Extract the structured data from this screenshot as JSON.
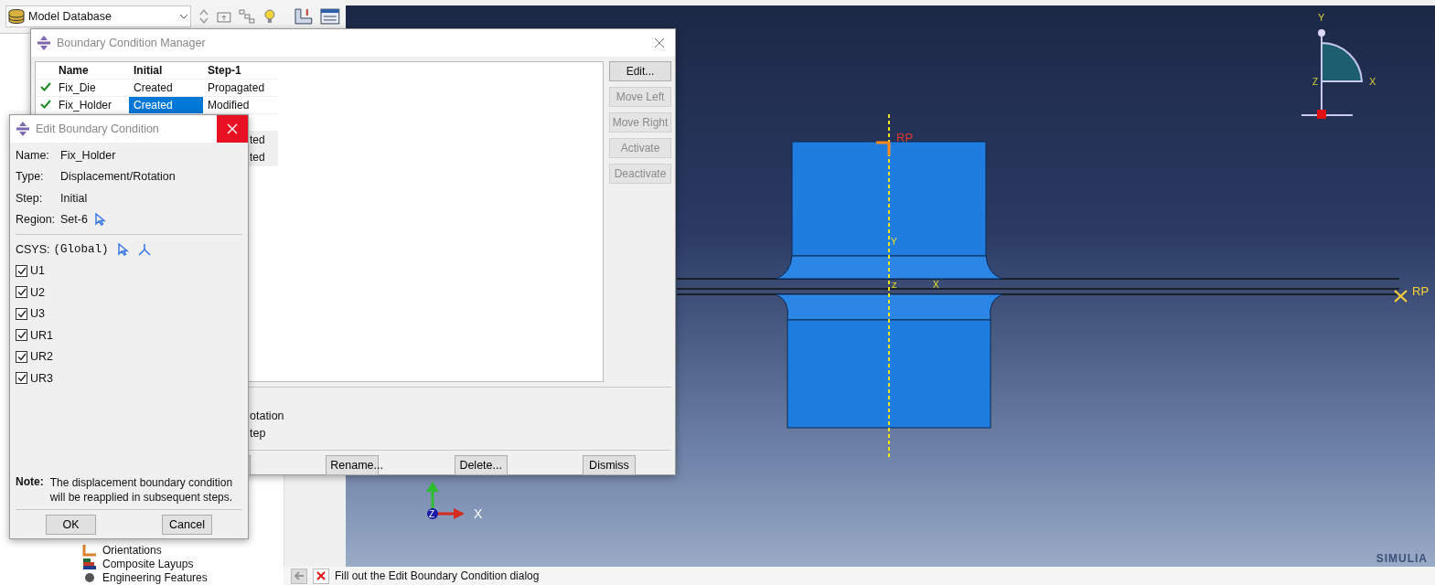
{
  "toolbar": {
    "context": "Model Database"
  },
  "tree": {
    "items": [
      {
        "label": "Orientations",
        "kind": "orientation"
      },
      {
        "label": "Composite Layups",
        "kind": "layup"
      },
      {
        "label": "Engineering Features",
        "kind": "feature"
      }
    ]
  },
  "viewport": {
    "rp_top": "RP",
    "rp_right": "RP",
    "axis_y": "Y",
    "axis_x": "X",
    "axis_z": "Z",
    "triad_x": "X",
    "triad_z": "Z",
    "view_y": "Y",
    "view_x": "X",
    "view_z": "Z"
  },
  "prompt": {
    "text": "Fill out the Edit Boundary Condition dialog"
  },
  "brand": "SIMULIA",
  "manager": {
    "title": "Boundary Condition Manager",
    "columns": [
      "Name",
      "Initial",
      "Step-1"
    ],
    "rows": [
      {
        "active": true,
        "name": "Fix_Die",
        "initial": "Created",
        "initial_selected": false,
        "step_1": "Propagated",
        "shaded": false
      },
      {
        "active": true,
        "name": "Fix_Holder",
        "initial": "Created",
        "initial_selected": true,
        "step_1": "Modified",
        "shaded": false
      },
      {
        "shaded": false
      },
      {
        "step_1": "ted",
        "shaded": true
      },
      {
        "step_1": "ted",
        "shaded": true
      }
    ],
    "side_buttons": [
      {
        "label": "Edit...",
        "disabled": false
      },
      {
        "label": "Move Left",
        "disabled": true
      },
      {
        "label": "Move Right",
        "disabled": true
      },
      {
        "label": "Activate",
        "disabled": true
      },
      {
        "label": "Deactivate",
        "disabled": true
      }
    ],
    "info": [
      "otation",
      "tep"
    ],
    "buttons": [
      "Rename...",
      "Delete...",
      "Dismiss"
    ]
  },
  "edit": {
    "title": "Edit Boundary Condition",
    "close_hovered": true,
    "fields": [
      {
        "label": "Name:",
        "value": "Fix_Holder",
        "kind": "text"
      },
      {
        "label": "Type:",
        "value": "Displacement/Rotation",
        "kind": "text"
      },
      {
        "label": "Step:",
        "value": "Initial",
        "kind": "text"
      },
      {
        "label": "Region:",
        "value": "Set-6",
        "kind": "pick"
      }
    ],
    "csys": {
      "label": "CSYS:",
      "value": "(Global)"
    },
    "dofs": [
      {
        "label": "U1",
        "checked": true
      },
      {
        "label": "U2",
        "checked": true
      },
      {
        "label": "U3",
        "checked": true
      },
      {
        "label": "UR1",
        "checked": true
      },
      {
        "label": "UR2",
        "checked": true
      },
      {
        "label": "UR3",
        "checked": true
      }
    ],
    "note": {
      "label": "Note:",
      "text": "The displacement boundary condition will be reapplied in subsequent steps."
    },
    "buttons": [
      "OK",
      "Cancel"
    ]
  }
}
